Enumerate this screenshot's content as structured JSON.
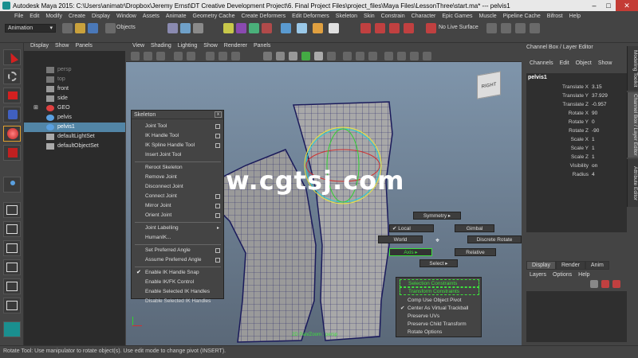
{
  "title": "Autodesk Maya 2015: C:\\Users\\animatr\\Dropbox\\Jeremy Ernst\\DT Creative Development Project\\6. Final Project Files\\project_files\\Maya Files\\LessonThree\\start.ma*   ---   pelvis1",
  "menubar": [
    "File",
    "Edit",
    "Modify",
    "Create",
    "Display",
    "Window",
    "Assets",
    "Animate",
    "Geometry Cache",
    "Create Deformers",
    "Edit Deformers",
    "Skeleton",
    "Skin",
    "Constrain",
    "Character",
    "Epic Games",
    "Muscle",
    "Pipeline Cache",
    "Bifrost",
    "Help"
  ],
  "statusline": {
    "mode": "Animation",
    "objects_label": "Objects",
    "live_surface": "No Live Surface"
  },
  "outliner": {
    "menu": [
      "Display",
      "Show",
      "Panels"
    ],
    "items": [
      {
        "label": "persp",
        "dim": true
      },
      {
        "label": "top",
        "dim": true
      },
      {
        "label": "front",
        "dim": false
      },
      {
        "label": "side",
        "dim": false
      },
      {
        "label": "GEO",
        "dim": false
      },
      {
        "label": "pelvis",
        "dim": false
      },
      {
        "label": "pelvis1",
        "dim": false,
        "selected": true
      },
      {
        "label": "defaultLightSet",
        "dim": false
      },
      {
        "label": "defaultObjectSet",
        "dim": false
      }
    ]
  },
  "viewport": {
    "menu": [
      "View",
      "Shading",
      "Lighting",
      "Show",
      "Renderer",
      "Panels"
    ],
    "viewcube_label": "RIGHT",
    "bottom_label": "2D Pan/Zoom : persp",
    "watermark": "www.cgtsj.com"
  },
  "skeleton_menu": {
    "title": "Skeleton",
    "close": "x",
    "items": [
      {
        "label": "Joint Tool",
        "opt": "box"
      },
      {
        "label": "IK Handle Tool",
        "opt": "box"
      },
      {
        "label": "IK Spline Handle Tool",
        "opt": "box"
      },
      {
        "label": "Insert Joint Tool",
        "opt": ""
      },
      {
        "label": "Reroot Skeleton",
        "opt": ""
      },
      {
        "label": "Remove Joint",
        "opt": ""
      },
      {
        "label": "Disconnect Joint",
        "opt": ""
      },
      {
        "label": "Connect Joint",
        "opt": "box"
      },
      {
        "label": "Mirror Joint",
        "opt": "box"
      },
      {
        "label": "Orient Joint",
        "opt": "box"
      },
      {
        "label": "Joint Labelling",
        "opt": "arrow"
      },
      {
        "label": "HumanIK...",
        "opt": ""
      },
      {
        "label": "Set Preferred Angle",
        "opt": "box"
      },
      {
        "label": "Assume Preferred Angle",
        "opt": "box"
      },
      {
        "label": "Enable IK Handle Snap",
        "opt": "",
        "check": true
      },
      {
        "label": "Enable IK/FK Control",
        "opt": ""
      },
      {
        "label": "Enable Selected IK Handles",
        "opt": ""
      },
      {
        "label": "Disable Selected IK Handles",
        "opt": ""
      }
    ]
  },
  "marking_menu": {
    "symmetry": "Symmetry",
    "local": "Local",
    "gimbal": "Gimbal",
    "world": "World",
    "discrete_rotate": "Discrete Rotate",
    "axis": "Axis",
    "relative": "Relative",
    "select": "Select",
    "selection_constraints": "Selection Constraints",
    "transform_constraints": "Transform Constraints",
    "comp_use_object_pivot": "Comp Use Object Pivot",
    "center_as_virtual_trackball": "Center As Virtual Trackball",
    "preserve_uvs": "Preserve UVs",
    "preserve_child_transform": "Preserve Child Transform",
    "rotate_options": "Rotate Options"
  },
  "channel_box": {
    "header": "Channel Box / Layer Editor",
    "menu": [
      "Channels",
      "Edit",
      "Object",
      "Show"
    ],
    "object": "pelvis1",
    "channels": [
      {
        "name": "Translate X",
        "value": "3.15"
      },
      {
        "name": "Translate Y",
        "value": "37.929"
      },
      {
        "name": "Translate Z",
        "value": "-0.957"
      },
      {
        "name": "Rotate X",
        "value": "90"
      },
      {
        "name": "Rotate Y",
        "value": "0"
      },
      {
        "name": "Rotate Z",
        "value": "-90"
      },
      {
        "name": "Scale X",
        "value": "1"
      },
      {
        "name": "Scale Y",
        "value": "1"
      },
      {
        "name": "Scale Z",
        "value": "1"
      },
      {
        "name": "Visibility",
        "value": "on"
      },
      {
        "name": "Radius",
        "value": "4"
      }
    ],
    "side_tabs": [
      "Modeling Toolkit",
      "Channel Box / Layer Editor",
      "Attribute Editor"
    ],
    "layer_tabs": [
      "Display",
      "Render",
      "Anim"
    ],
    "layer_menu": [
      "Layers",
      "Options",
      "Help"
    ]
  },
  "helpline": "Rotate Tool: Use manipulator to rotate object(s). Use edit mode to change pivot (INSERT).",
  "colors": {
    "selection": "#5285a6",
    "green_highlight": "#3de03d",
    "panel": "#444444",
    "viewport_top": "#7f95ab"
  }
}
